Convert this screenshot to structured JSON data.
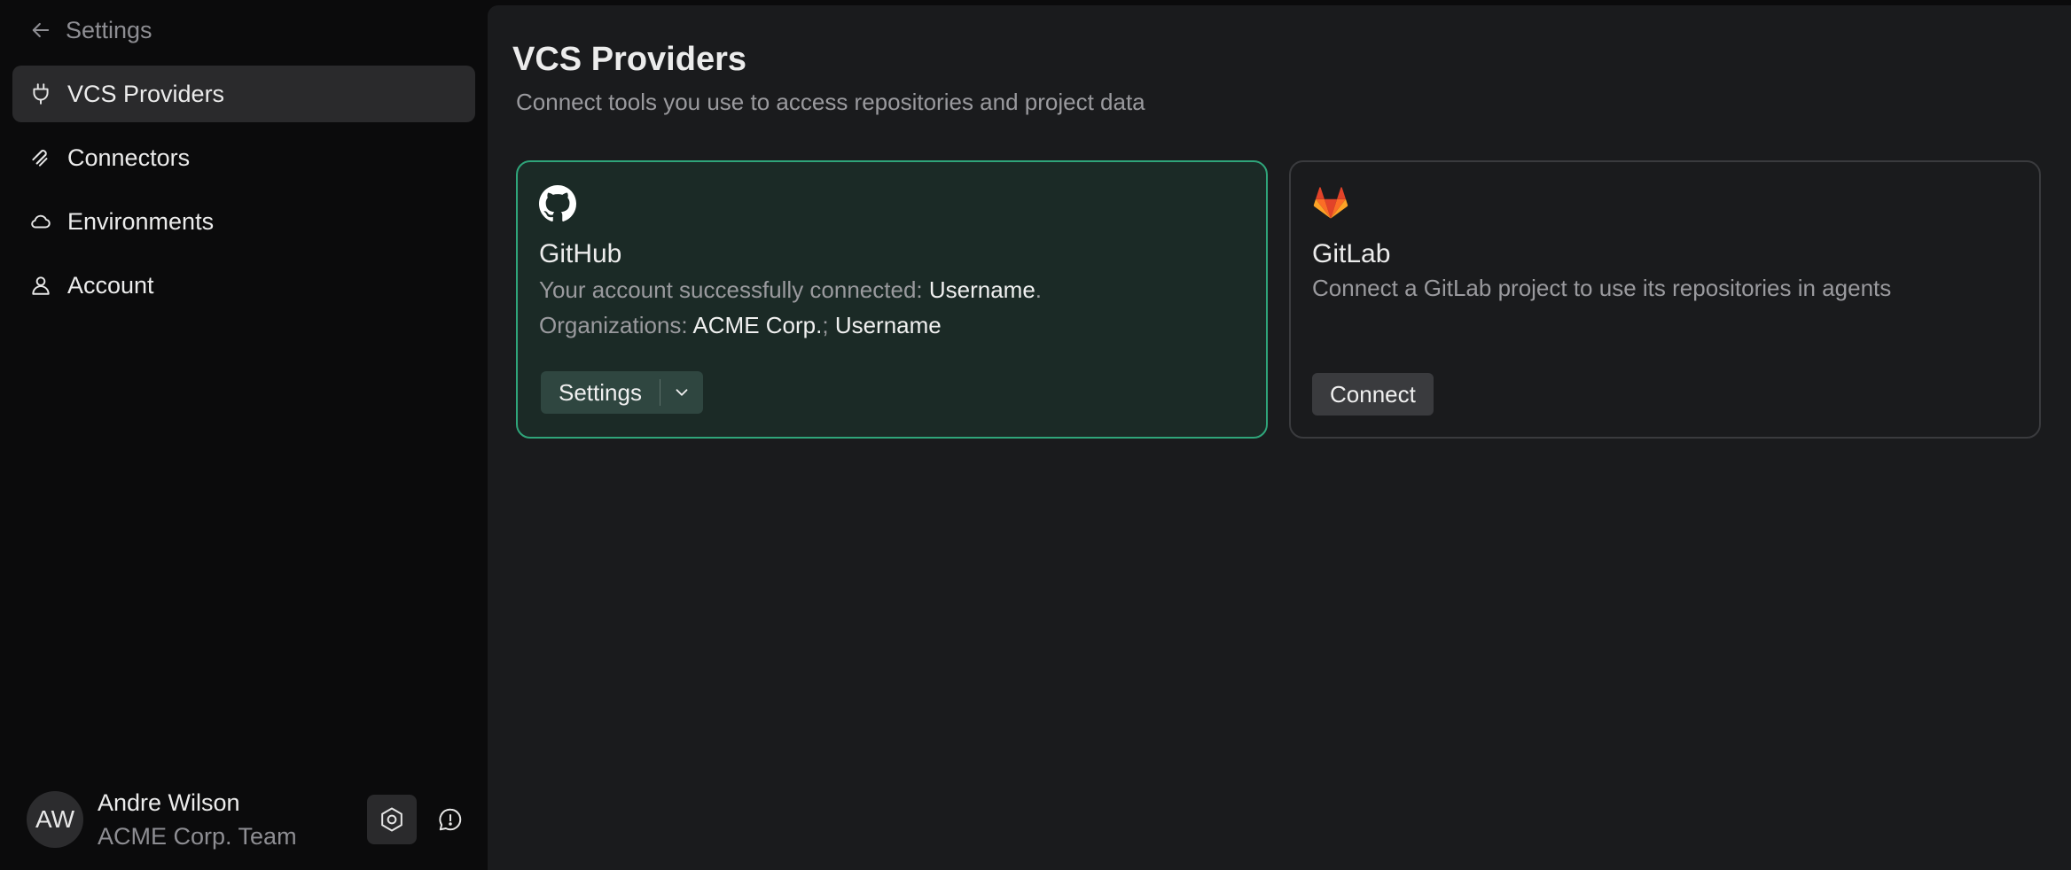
{
  "sidebar": {
    "back_label": "Settings",
    "items": [
      {
        "label": "VCS Providers",
        "icon": "plug-icon",
        "active": true
      },
      {
        "label": "Connectors",
        "icon": "connectors-icon",
        "active": false
      },
      {
        "label": "Environments",
        "icon": "cloud-icon",
        "active": false
      },
      {
        "label": "Account",
        "icon": "user-icon",
        "active": false
      }
    ],
    "user": {
      "initials": "AW",
      "name": "Andre Wilson",
      "team": "ACME Corp. Team"
    }
  },
  "main": {
    "title": "VCS Providers",
    "subtitle": "Connect tools you use to access repositories and project data",
    "github": {
      "title": "GitHub",
      "connected_prefix": "Your account successfully connected: ",
      "username": "Username",
      "period": ".",
      "orgs_prefix": "Organizations: ",
      "org_one": "ACME Corp.",
      "separator": "; ",
      "org_two": "Username",
      "button_label": "Settings"
    },
    "gitlab": {
      "title": "GitLab",
      "description": "Connect a GitLab project to use its repositories in agents",
      "button_label": "Connect"
    }
  },
  "colors": {
    "accent_border": "#2fa57a",
    "github_card_bg": "#1b2a26",
    "gitlab_orange": "#e24329"
  }
}
